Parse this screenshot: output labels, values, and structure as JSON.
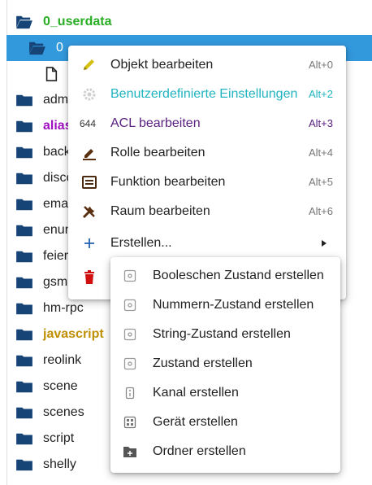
{
  "tree": {
    "root": {
      "label": "0_userdata",
      "icon": "folder-open-icon"
    },
    "selected": {
      "label": "0",
      "icon": "folder-open-icon"
    },
    "file": {
      "icon": "file-icon"
    },
    "items": [
      {
        "label": "adm"
      },
      {
        "label": "alias"
      },
      {
        "label": "back"
      },
      {
        "label": "disco"
      },
      {
        "label": "ema"
      },
      {
        "label": "enum"
      },
      {
        "label": "feier"
      },
      {
        "label": "gsm"
      },
      {
        "label": "hm-rpc"
      },
      {
        "label": "javascript"
      },
      {
        "label": "reolink"
      },
      {
        "label": "scene"
      },
      {
        "label": "scenes"
      },
      {
        "label": "script"
      },
      {
        "label": "shelly"
      }
    ]
  },
  "context_menu": {
    "items": [
      {
        "label": "Objekt bearbeiten",
        "shortcut": "Alt+0",
        "icon": "pencil-icon"
      },
      {
        "label": "Benutzerdefinierte Einstellungen",
        "shortcut": "Alt+2",
        "icon": "gear-icon"
      },
      {
        "label": "ACL bearbeiten",
        "shortcut": "Alt+3",
        "icon_text": "644"
      },
      {
        "label": "Rolle bearbeiten",
        "shortcut": "Alt+4",
        "icon": "pen-edit-icon"
      },
      {
        "label": "Funktion bearbeiten",
        "shortcut": "Alt+5",
        "icon": "function-icon"
      },
      {
        "label": "Raum bearbeiten",
        "shortcut": "Alt+6",
        "icon": "tools-icon"
      },
      {
        "label": "Erstellen...",
        "icon": "plus-icon"
      }
    ],
    "delete_icon": "trash-icon"
  },
  "submenu": {
    "items": [
      {
        "label": "Booleschen Zustand erstellen",
        "icon": "state-icon"
      },
      {
        "label": "Nummern-Zustand erstellen",
        "icon": "state-icon"
      },
      {
        "label": "String-Zustand erstellen",
        "icon": "state-icon"
      },
      {
        "label": "Zustand erstellen",
        "icon": "state-icon"
      },
      {
        "label": "Kanal erstellen",
        "icon": "channel-icon"
      },
      {
        "label": "Gerät erstellen",
        "icon": "device-icon"
      },
      {
        "label": "Ordner erstellen",
        "icon": "folder-plus-icon"
      }
    ]
  },
  "colors": {
    "selection": "#3399dd",
    "folder": "#164477",
    "root_text": "#27ae22",
    "alias_text": "#a010c0",
    "javascript_text": "#c09000",
    "disabled_text": "#1fb4c0",
    "delete": "#d01010"
  }
}
